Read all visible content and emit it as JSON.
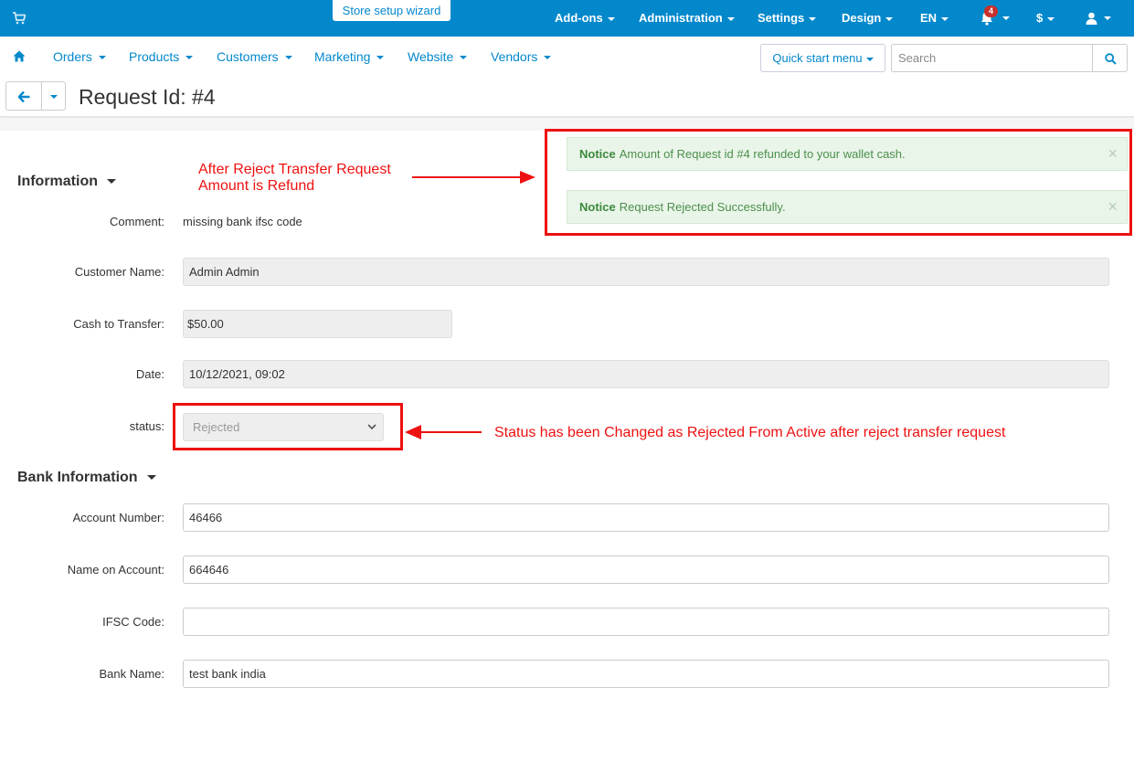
{
  "topbar": {
    "wizard": "Store setup wizard",
    "addons": "Add-ons",
    "administration": "Administration",
    "settings": "Settings",
    "design": "Design",
    "language": "EN",
    "notifications_count": "4",
    "currency": "$"
  },
  "nav": {
    "orders": "Orders",
    "products": "Products",
    "customers": "Customers",
    "marketing": "Marketing",
    "website": "Website",
    "vendors": "Vendors",
    "quick_start": "Quick start menu",
    "search_placeholder": "Search"
  },
  "page": {
    "title": "Request Id: #4"
  },
  "notices": [
    {
      "label": "Notice",
      "text": "Amount of Request id #4 refunded to your wallet cash.",
      "close": "×"
    },
    {
      "label": "Notice",
      "text": "Request Rejected Successfully.",
      "close": "×"
    }
  ],
  "information": {
    "heading": "Information",
    "comment_label": "Comment:",
    "comment_value": "missing bank ifsc code",
    "customer_label": "Customer Name:",
    "customer_value": "Admin Admin",
    "cash_label": "Cash to Transfer:",
    "cash_value": "$50.00",
    "date_label": "Date:",
    "date_value": "10/12/2021, 09:02",
    "status_label": "status:",
    "status_value": "Rejected"
  },
  "bank": {
    "heading": "Bank Information",
    "account_label": "Account Number:",
    "account_value": "46466",
    "name_label": "Name on Account:",
    "name_value": "664646",
    "ifsc_label": "IFSC Code:",
    "ifsc_value": "",
    "bank_label": "Bank Name:",
    "bank_value": "test bank india"
  },
  "annotations": {
    "refund_line1": "After Reject Transfer Request",
    "refund_line2": "Amount is Refund",
    "status_note": "Status has been Changed as Rejected From Active after reject transfer request",
    "color": "#ee1111"
  },
  "colors": {
    "primary": "#0388cc",
    "notice_bg": "#eaf5ea",
    "notice_text": "#4b8f4b",
    "badge": "#c9302c"
  }
}
